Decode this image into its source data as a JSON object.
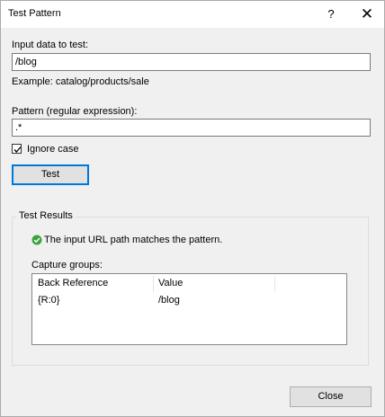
{
  "window": {
    "title": "Test Pattern",
    "help_label": "?",
    "close_glyph": "✕"
  },
  "input": {
    "label": "Input data to test:",
    "value": "/blog",
    "example": "Example: catalog/products/sale"
  },
  "pattern": {
    "label": "Pattern (regular expression):",
    "value": ".*"
  },
  "ignore_case": {
    "label": "Ignore case",
    "checked": true
  },
  "test_button": {
    "label": "Test"
  },
  "results": {
    "group_title": "Test Results",
    "status_icon": "success-check-icon",
    "status_color": "#3ca33c",
    "status_text": "The input URL path matches the pattern.",
    "capture_label": "Capture groups:",
    "columns": [
      "Back Reference",
      "Value"
    ],
    "rows": [
      {
        "back_reference": "{R:0}",
        "value": "/blog"
      }
    ]
  },
  "close_button": {
    "label": "Close"
  }
}
